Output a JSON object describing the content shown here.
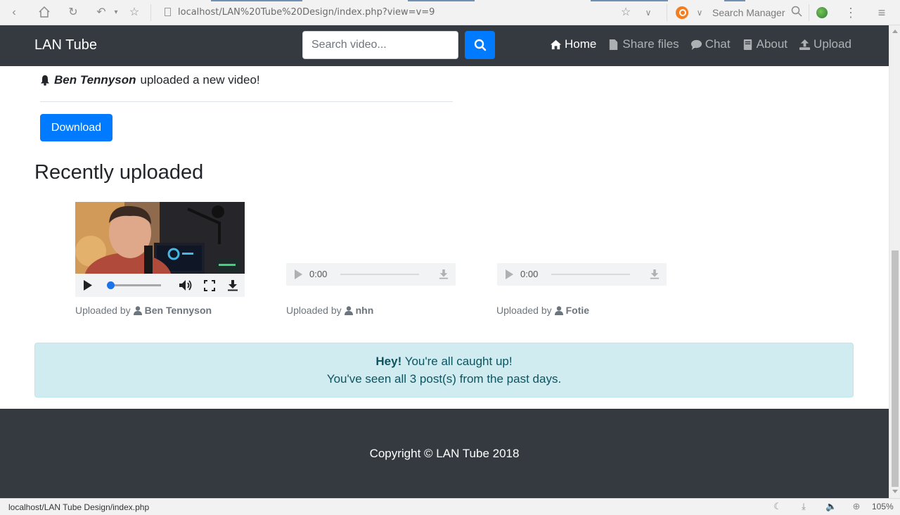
{
  "browser": {
    "url": "localhost/LAN%20Tube%20Design/index.php?view=v=9",
    "search_manager": "Search Manager"
  },
  "navbar": {
    "brand": "LAN Tube",
    "search_placeholder": "Search video...",
    "links": [
      {
        "label": "Home",
        "active": true
      },
      {
        "label": "Share files",
        "active": false
      },
      {
        "label": "Chat",
        "active": false
      },
      {
        "label": "About",
        "active": false
      },
      {
        "label": "Upload",
        "active": false
      }
    ]
  },
  "notification": {
    "user": "Ben Tennyson",
    "text": "uploaded a new video!"
  },
  "download_label": "Download",
  "recent": {
    "title": "Recently uploaded",
    "uploaded_by_label": "Uploaded by",
    "items": [
      {
        "type": "video",
        "uploader": "Ben Tennyson"
      },
      {
        "type": "audio",
        "time": "0:00",
        "uploader": "nhn"
      },
      {
        "type": "audio",
        "time": "0:00",
        "uploader": "Fotie"
      }
    ]
  },
  "alert": {
    "strong": "Hey!",
    "line1": "You're all caught up!",
    "line2": "You've seen all 3 post(s) from the past days."
  },
  "footer": {
    "copyright": "Copyright © LAN Tube 2018"
  },
  "status_bar": {
    "url": "localhost/LAN Tube Design/index.php",
    "zoom": "105%"
  },
  "colors": {
    "navbar": "#343a40",
    "primary": "#007bff",
    "alert_bg": "#d1ecf1",
    "alert_text": "#0c5460"
  }
}
